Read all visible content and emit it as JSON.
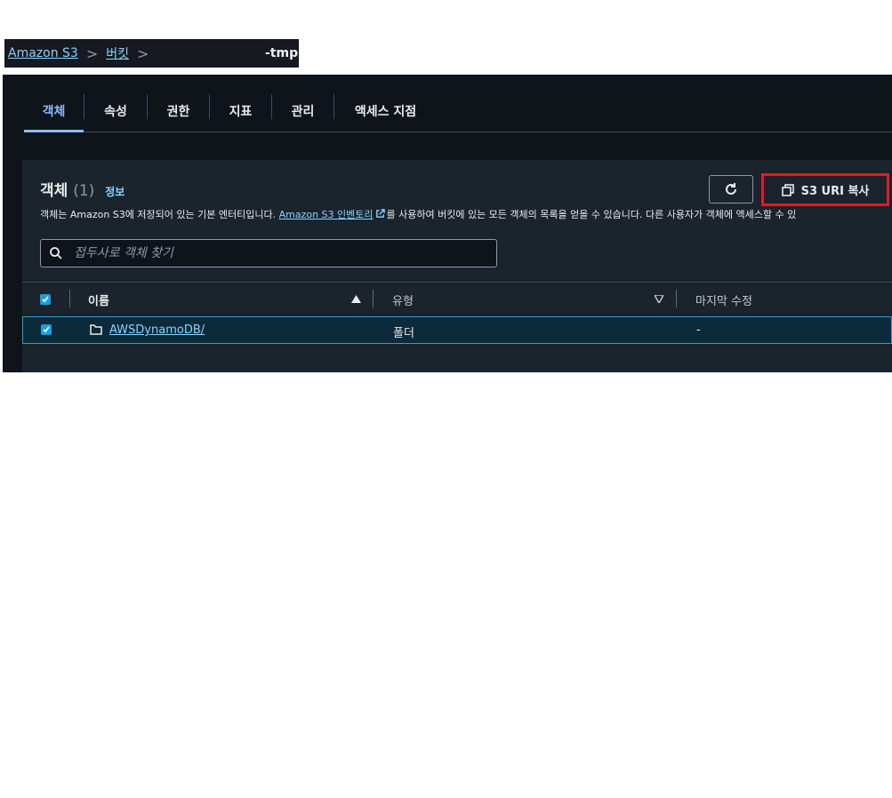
{
  "breadcrumb": {
    "root": "Amazon S3",
    "buckets": "버킷",
    "current": "-tmp"
  },
  "tabs": [
    {
      "label": "객체"
    },
    {
      "label": "속성"
    },
    {
      "label": "권한"
    },
    {
      "label": "지표"
    },
    {
      "label": "관리"
    },
    {
      "label": "액세스 지점"
    }
  ],
  "objects": {
    "title": "객체",
    "count": "(1)",
    "info": "정보",
    "desc_before": "객체는 Amazon S3에 저장되어 있는 기본 엔터티입니다. ",
    "desc_link": "Amazon S3 인벤토리",
    "desc_after": "를 사용하여 버킷에 있는 모든 객체의 목록을 얻을 수 있습니다. 다른 사용자가 객체에 액세스할 수 있",
    "copy_button": "S3 URI 복사",
    "search_placeholder": "접두사로 객체 찾기"
  },
  "table": {
    "columns": [
      "이름",
      "유형",
      "마지막 수정"
    ],
    "rows": [
      {
        "name": "AWSDynamoDB/",
        "type": "폴더",
        "modified": "-"
      }
    ]
  },
  "colors": {
    "accent": "#89bdff",
    "highlight_border": "#e31b23",
    "checkbox": "#1a9ee6"
  }
}
